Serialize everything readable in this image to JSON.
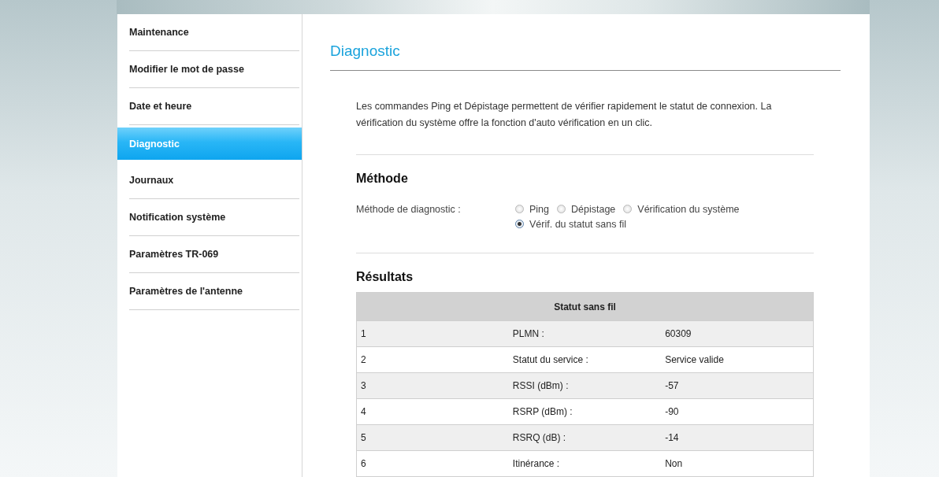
{
  "sidebar": {
    "items": [
      {
        "label": "Maintenance",
        "selected": false
      },
      {
        "label": "Modifier le mot de passe",
        "selected": false
      },
      {
        "label": "Date et heure",
        "selected": false
      },
      {
        "label": "Diagnostic",
        "selected": true
      },
      {
        "label": "Journaux",
        "selected": false
      },
      {
        "label": "Notification système",
        "selected": false
      },
      {
        "label": "Paramètres TR-069",
        "selected": false
      },
      {
        "label": "Paramètres de l'antenne",
        "selected": false
      }
    ]
  },
  "content": {
    "title": "Diagnostic",
    "description": "Les commandes Ping et Dépistage permettent de vérifier rapidement le statut de connexion. La vérification du système offre la fonction d'auto vérification en un clic.",
    "method_section": {
      "heading": "Méthode",
      "field_label": "Méthode de diagnostic :",
      "options": [
        {
          "label": "Ping",
          "selected": false
        },
        {
          "label": "Dépistage",
          "selected": false
        },
        {
          "label": "Vérification du système",
          "selected": false
        },
        {
          "label": "Vérif. du statut sans fil",
          "selected": true
        }
      ]
    },
    "results_section": {
      "heading": "Résultats",
      "table": {
        "title": "Statut sans fil",
        "rows": [
          {
            "index": "1",
            "name": "PLMN :",
            "value": "60309"
          },
          {
            "index": "2",
            "name": "Statut du service :",
            "value": "Service valide"
          },
          {
            "index": "3",
            "name": "RSSI (dBm) :",
            "value": "-57"
          },
          {
            "index": "4",
            "name": "RSRP (dBm) :",
            "value": "-90"
          },
          {
            "index": "5",
            "name": "RSRQ (dB) :",
            "value": "-14"
          },
          {
            "index": "6",
            "name": "Itinérance :",
            "value": "Non"
          }
        ]
      }
    }
  }
}
